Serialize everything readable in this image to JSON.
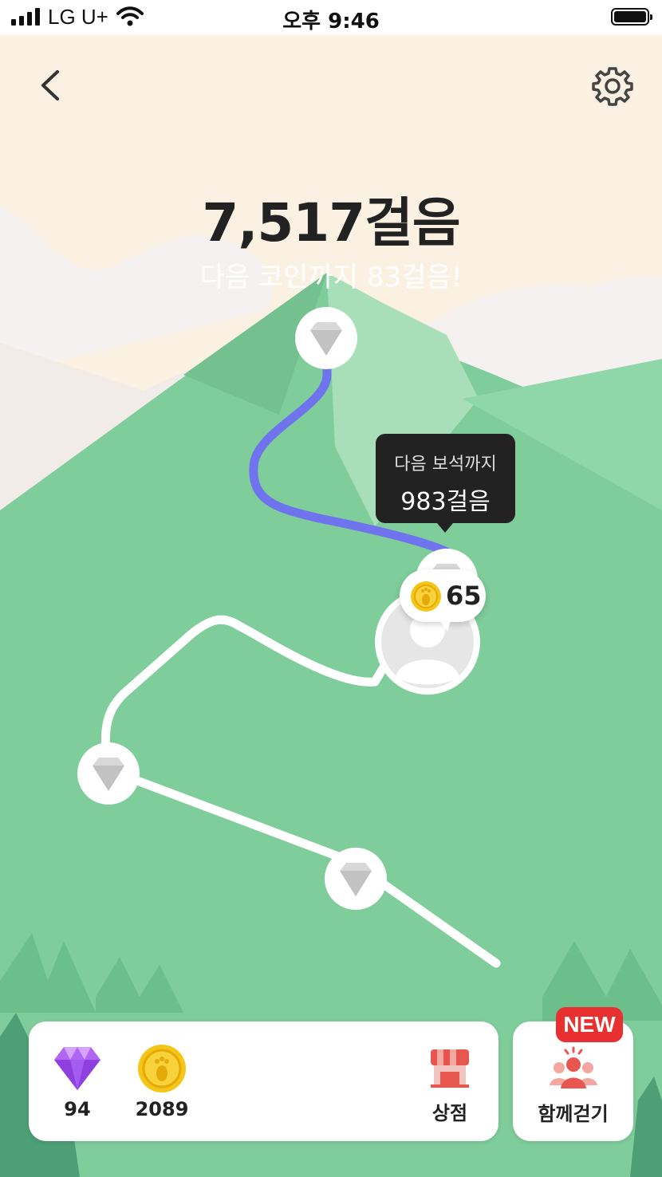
{
  "status_bar": {
    "carrier": "LG U+",
    "time": "오후 9:46"
  },
  "header": {
    "back_icon": "chevron-left-icon",
    "settings_icon": "gear-icon"
  },
  "walk": {
    "steps_today": "7,517걸음",
    "next_coin_message": "다음 코인까지 83걸음!"
  },
  "tooltip": {
    "line1": "다음 보석까지",
    "line2": "983걸음"
  },
  "avatar_coin": {
    "value": "65"
  },
  "wallet": {
    "gems": "94",
    "coins": "2089"
  },
  "shop": {
    "label": "상점",
    "icon": "shop-icon"
  },
  "walk_together": {
    "label": "함께걷기",
    "badge": "NEW",
    "icon": "group-icon"
  },
  "colors": {
    "mountain": "#7fcd9b",
    "sky": "#fbf1e2",
    "route_progress": "#6f74ee",
    "route_remaining": "#ffffff",
    "new_badge": "#e83030"
  }
}
